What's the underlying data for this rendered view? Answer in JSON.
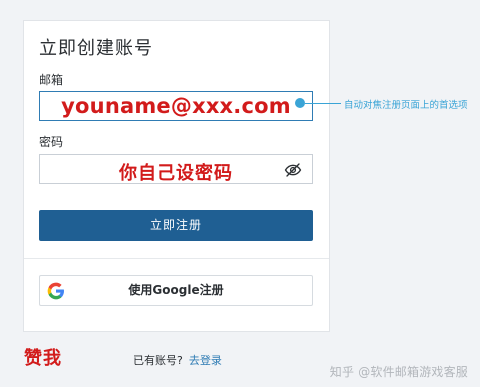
{
  "form": {
    "title": "立即创建账号",
    "email_label": "邮箱",
    "email_value": "youname@xxx.com",
    "password_label": "密码",
    "password_value": "你自己设密码",
    "submit_label": "立即注册",
    "google_label": "使用Google注册"
  },
  "annotation": {
    "text": "自动对焦注册页面上的首选项"
  },
  "footer": {
    "zan": "赞我",
    "have_account": "已有账号?",
    "login_link": "去登录"
  },
  "watermark": "知乎 @软件邮箱游戏客服",
  "colors": {
    "primary": "#1f5f93",
    "annotation": "#3aa4d6",
    "accent_red": "#d21b1b"
  },
  "icons": {
    "password_toggle": "eye-off-icon",
    "google": "google-g-icon"
  }
}
